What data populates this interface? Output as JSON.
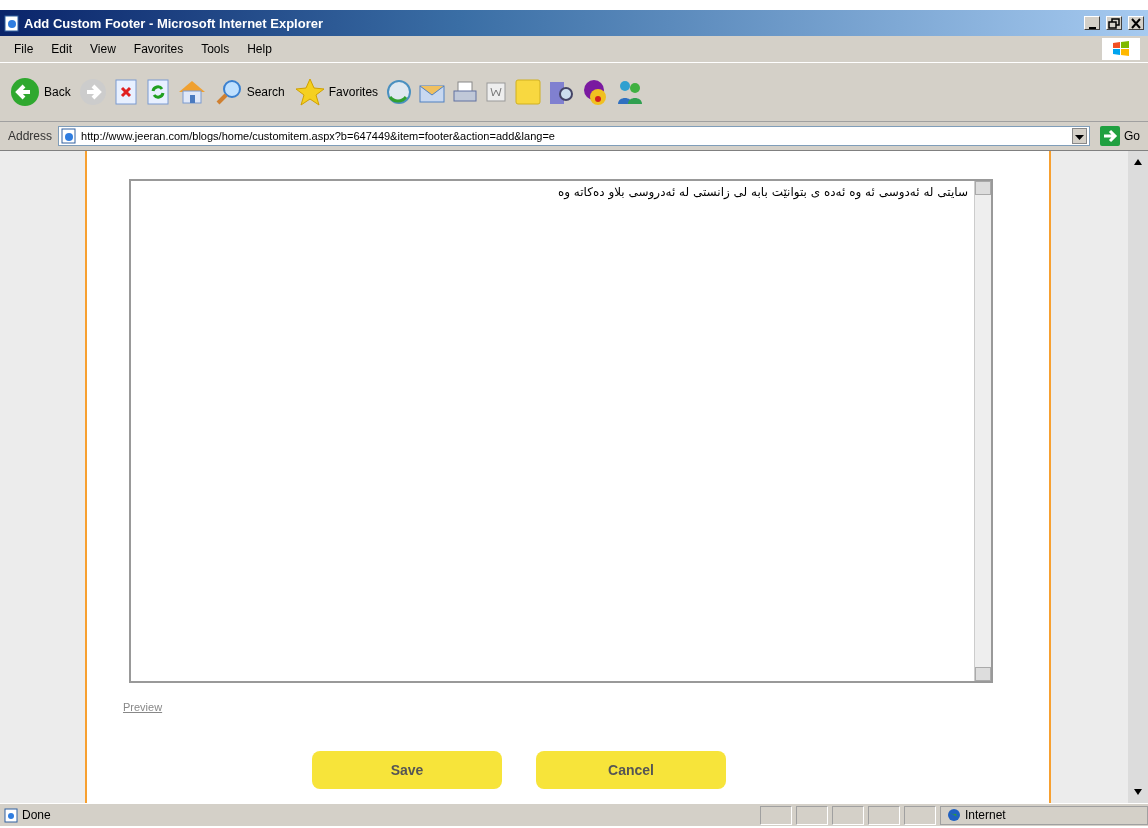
{
  "window": {
    "title": "Add Custom Footer - Microsoft Internet Explorer"
  },
  "menu": [
    "File",
    "Edit",
    "View",
    "Favorites",
    "Tools",
    "Help"
  ],
  "toolbar": {
    "back": "Back",
    "search": "Search",
    "favorites": "Favorites"
  },
  "address": {
    "label": "Address",
    "url": "http://www.jeeran.com/blogs/home/customitem.aspx?b=647449&item=footer&action=add&lang=e",
    "go": "Go"
  },
  "editor": {
    "value": "سایتی لە ئەدوسی ئە وە ئەدە ی بتوانێت بابە لی زانستی لە ئەدروسی بلاو دەکاتە وە"
  },
  "preview_link": "Preview",
  "buttons": [
    "Save",
    "Cancel"
  ],
  "status_bar": {
    "text": "Done",
    "zone": "Internet"
  }
}
